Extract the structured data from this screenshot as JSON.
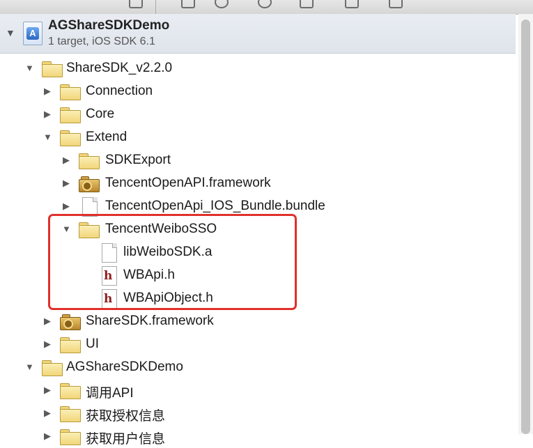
{
  "project": {
    "name": "AGShareSDKDemo",
    "subtitle": "1 target, iOS SDK 6.1"
  },
  "tree": {
    "sharesdk_group": "ShareSDK_v2.2.0",
    "connection": "Connection",
    "core": "Core",
    "extend": "Extend",
    "sdkexport": "SDKExport",
    "tencent_openapi_framework": "TencentOpenAPI.framework",
    "tencent_openapi_bundle": "TencentOpenApi_IOS_Bundle.bundle",
    "tencent_weibo_sso": "TencentWeiboSSO",
    "lib_weibo_sdk": "libWeiboSDK.a",
    "wbapi_h": "WBApi.h",
    "wbapi_object_h": "WBApiObject.h",
    "sharesdk_framework": "ShareSDK.framework",
    "ui": "UI",
    "demo_group": "AGShareSDKDemo",
    "call_api": "调用API",
    "get_auth_info": "获取授权信息",
    "get_user_info": "获取用户信息"
  },
  "colors": {
    "highlight": "#e0302b",
    "folder": "#f1d67a",
    "header_icon": "#d0b07a"
  }
}
